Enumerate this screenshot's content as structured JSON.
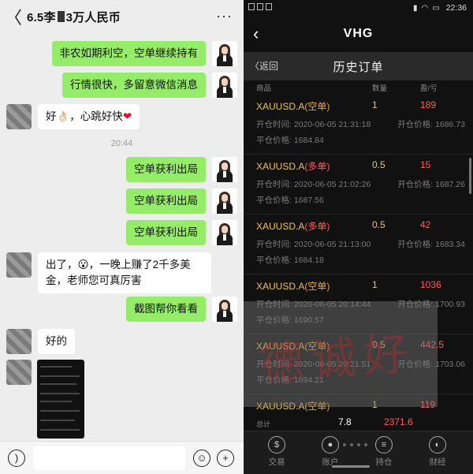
{
  "chat": {
    "title_pre": "6.5李",
    "title_post": "3万人民币",
    "more": "···",
    "back": "〈",
    "messages": [
      {
        "side": "right",
        "text": "非农如期利空，空单继续持有"
      },
      {
        "side": "right",
        "text": "行情很快，多留意微信消息"
      },
      {
        "side": "left",
        "text": "好👌🏻，心跳好快",
        "heart": "❤"
      },
      {
        "side": "right",
        "text": "空单获利出局"
      },
      {
        "side": "right",
        "text": "空单获利出局"
      },
      {
        "side": "right",
        "text": "空单获利出局"
      },
      {
        "side": "left",
        "text": "出了，😮，一晚上赚了2千多美金，老师您可真厉害"
      },
      {
        "side": "right",
        "text": "截图帮你看看"
      },
      {
        "side": "left",
        "text": "好的"
      }
    ],
    "timestamp": "20:44",
    "input": {
      "voice_icon": "voice-icon",
      "emoji_icon": "emoji-icon",
      "plus_icon": "plus-icon"
    }
  },
  "app": {
    "status_time": "22:36",
    "nav_title": "VHG",
    "back_label": "〈返回",
    "page_title": "历史订单",
    "columns": {
      "product": "商品",
      "qty": "数量",
      "pl": "盈/亏"
    },
    "orders": [
      {
        "symbol": "XAUUSD.A",
        "dir": "(空单)",
        "kind": "short",
        "qty": "1",
        "pl": "189",
        "open_time_label": "开仓时间:",
        "open_time": "2020-06-05 21:31:18",
        "open_price_label": "开仓价格:",
        "open_price": "1686.73",
        "close_price_label": "平仓价格:",
        "close_price": "1684.84"
      },
      {
        "symbol": "XAUUSD.A",
        "dir": "(多单)",
        "kind": "long",
        "qty": "0.5",
        "pl": "15",
        "open_time_label": "开仓时间:",
        "open_time": "2020-06-05 21:02:26",
        "open_price_label": "开仓价格:",
        "open_price": "1687.26",
        "close_price_label": "平仓价格:",
        "close_price": "1687.56"
      },
      {
        "symbol": "XAUUSD.A",
        "dir": "(多单)",
        "kind": "long",
        "qty": "0.5",
        "pl": "42",
        "open_time_label": "开仓时间:",
        "open_time": "2020-06-05 21:13:00",
        "open_price_label": "开仓价格:",
        "open_price": "1683.34",
        "close_price_label": "平仓价格:",
        "close_price": "1684.18"
      },
      {
        "symbol": "XAUUSD.A",
        "dir": "(空单)",
        "kind": "short",
        "qty": "1",
        "pl": "1036",
        "open_time_label": "开仓时间:",
        "open_time": "2020-06-05 20:14:44",
        "open_price_label": "开仓价格:",
        "open_price": "1700.93",
        "close_price_label": "平仓价格:",
        "close_price": "1690.57"
      },
      {
        "symbol": "XAUUSD.A",
        "dir": "(空单)",
        "kind": "short",
        "qty": "0.5",
        "pl": "442.5",
        "open_time_label": "开仓时间:",
        "open_time": "2020-06-05 20:21:51",
        "open_price_label": "开仓价格:",
        "open_price": "1703.06",
        "close_price_label": "平仓价格:",
        "close_price": "1694.21"
      },
      {
        "symbol": "XAUUSD.A",
        "dir": "(空单)",
        "kind": "short",
        "qty": "1",
        "pl": "119"
      }
    ],
    "summary": {
      "label": "总计",
      "volume": "7.8",
      "total": "2371.6"
    },
    "tabs": [
      {
        "label": "交易",
        "icon": "dollar-icon",
        "glyph": "$"
      },
      {
        "label": "账户",
        "icon": "user-icon",
        "glyph": "●"
      },
      {
        "label": "持仓",
        "icon": "position-icon",
        "glyph": "≡"
      },
      {
        "label": "财经",
        "icon": "globe-icon",
        "glyph": "◐"
      }
    ],
    "colors": {
      "profit": "#ff5a5a",
      "symbol": "#f2c14e",
      "bg": "#111111"
    }
  }
}
